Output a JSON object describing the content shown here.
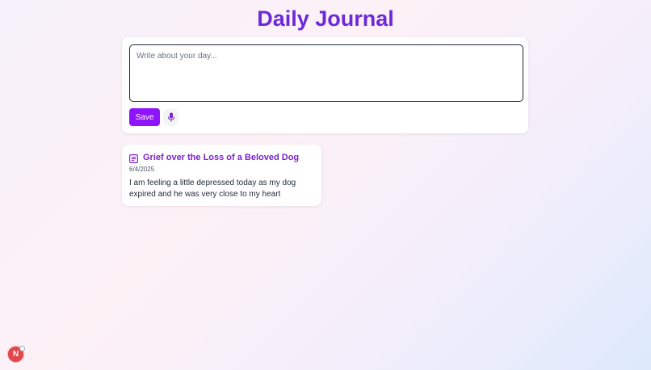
{
  "app": {
    "title": "Daily Journal",
    "accent_color": "#9013fe",
    "title_color": "#6d28d9"
  },
  "editor": {
    "placeholder": "Write about your day...",
    "value": "",
    "save_label": "Save",
    "mic_icon": "microphone-icon"
  },
  "entries": [
    {
      "icon": "journal-entry-icon",
      "title": "Grief over the Loss of a Beloved Dog",
      "date": "6/4/2025",
      "body": "I am feeling a little depressed today as my dog expired and he was very close to my heart"
    }
  ],
  "user": {
    "avatar_initial": "N",
    "avatar_color": "#e0474c"
  }
}
